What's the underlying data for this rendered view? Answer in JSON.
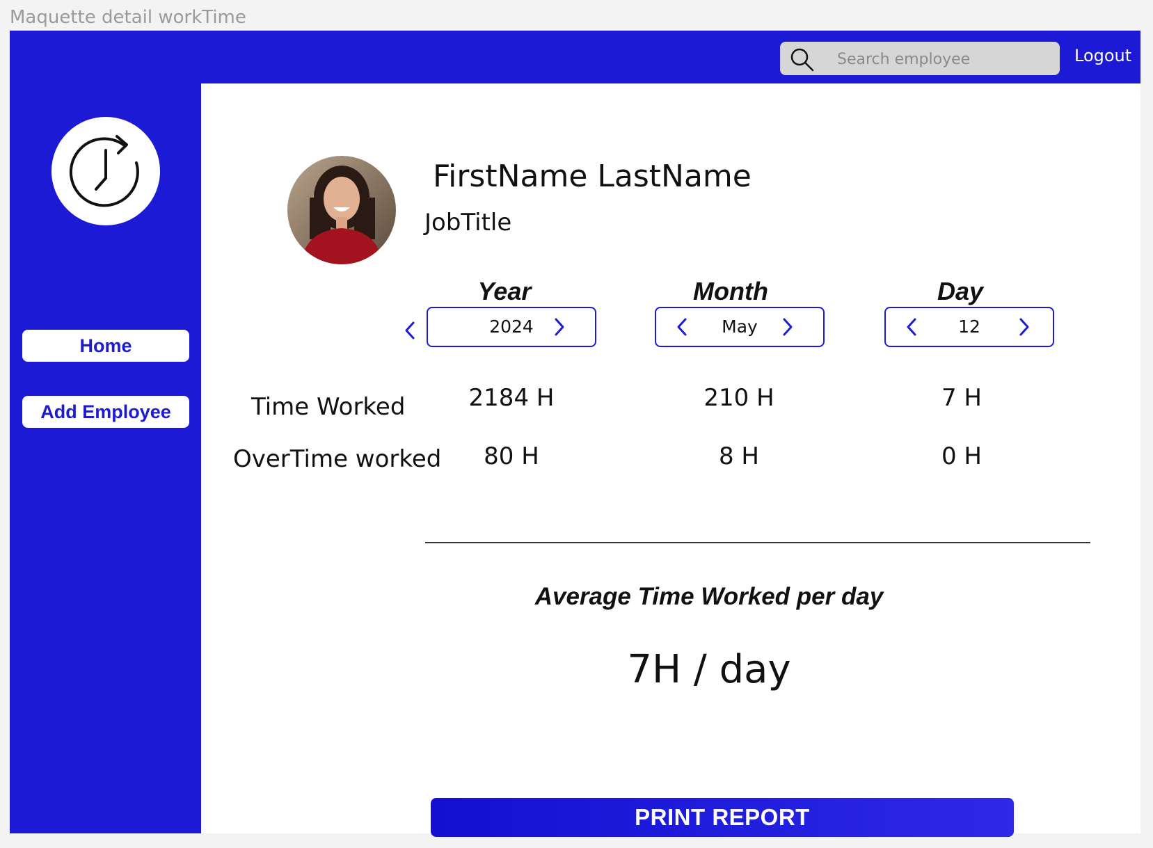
{
  "frame": {
    "title": "Maquette detail workTime"
  },
  "header": {
    "search": {
      "placeholder": "Search employee",
      "value": "",
      "icon": "search-icon"
    },
    "logout_label": "Logout"
  },
  "sidebar": {
    "logo_icon": "clock-refresh-icon",
    "items": [
      {
        "label": "Home"
      },
      {
        "label": "Add Employee"
      }
    ]
  },
  "profile": {
    "name": "FirstName LastName",
    "job_title": "JobTitle"
  },
  "periods": {
    "year": {
      "title": "Year",
      "value": "2024"
    },
    "month": {
      "title": "Month",
      "value": "May"
    },
    "day": {
      "title": "Day",
      "value": "12"
    }
  },
  "stats": {
    "rows": [
      {
        "label": "Time Worked",
        "year": "2184 H",
        "month": "210 H",
        "day": "7 H"
      },
      {
        "label": "OverTime worked",
        "year": "80 H",
        "month": "8 H",
        "day": "0 H"
      }
    ]
  },
  "average": {
    "title": "Average Time Worked per day",
    "value": "7H / day"
  },
  "actions": {
    "print_label": "PRINT REPORT"
  },
  "colors": {
    "primary": "#1d1ad6",
    "background": "#ffffff"
  }
}
